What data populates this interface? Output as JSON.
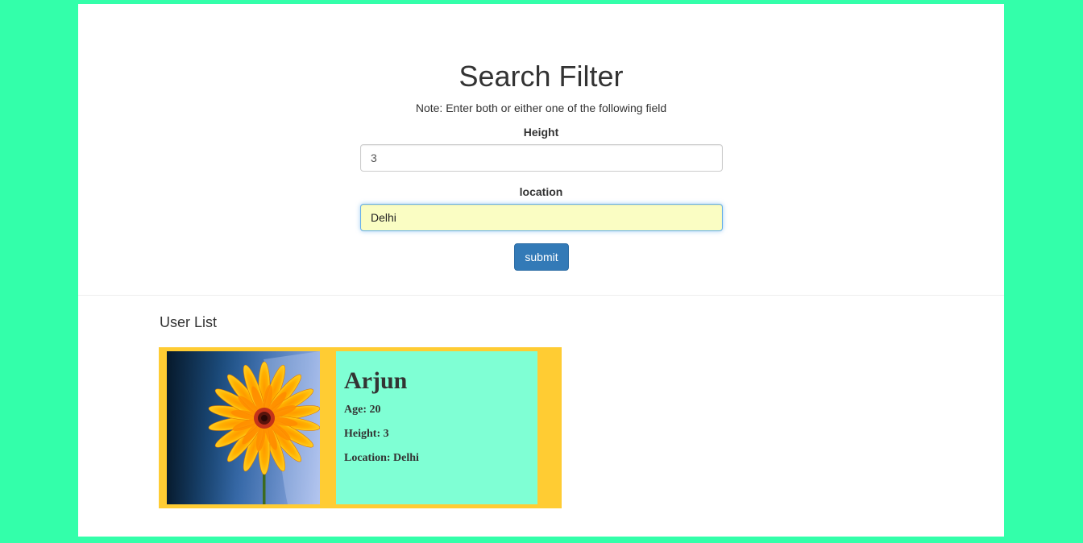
{
  "search": {
    "title": "Search Filter",
    "note": "Note: Enter both or either one of the following field",
    "height_label": "Height",
    "height_value": "3",
    "location_label": "location",
    "location_value": "Delhi",
    "submit_label": "submit"
  },
  "user_list": {
    "heading": "User List",
    "users": [
      {
        "name": "Arjun",
        "age": "Age: 20",
        "height": "Height: 3",
        "location": "Location: Delhi"
      }
    ]
  },
  "colors": {
    "page_background": "#33ffaa",
    "card_background": "#ffcc33",
    "info_background": "#7fffd4",
    "submit_button": "#337ab7",
    "autofill_input": "#fafdc3"
  }
}
